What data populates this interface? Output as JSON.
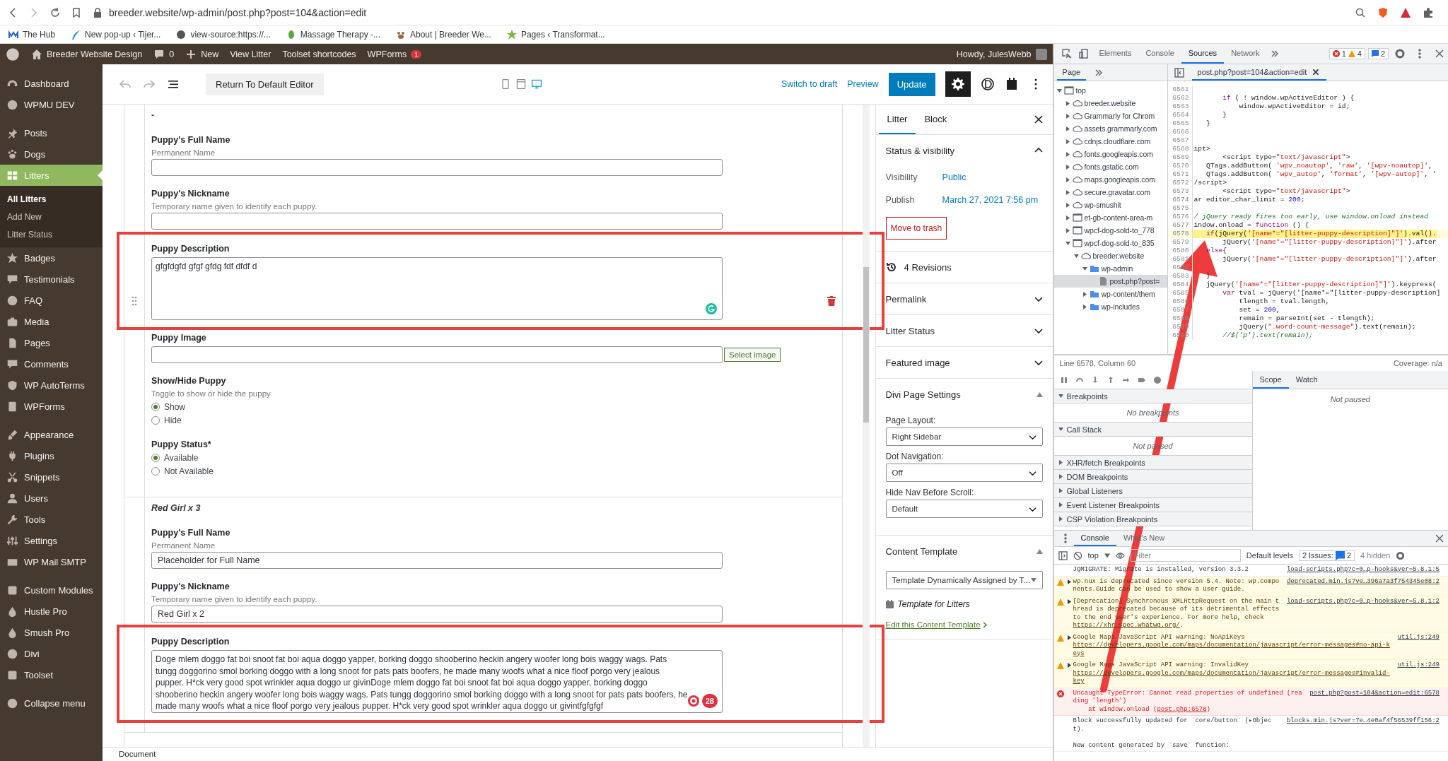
{
  "browser": {
    "url": "breeder.website/wp-admin/post.php?post=104&action=edit",
    "bookmarks": [
      {
        "kind": "hub",
        "label": "The Hub"
      },
      {
        "kind": "feather",
        "label": "New pop-up ‹ Tijer..."
      },
      {
        "kind": "globe",
        "label": "view-source:https://..."
      },
      {
        "kind": "leaf",
        "label": "Massage Therapy -..."
      },
      {
        "kind": "paw",
        "label": "About | Breeder We..."
      },
      {
        "kind": "star",
        "label": "Pages ‹ Transformat..."
      }
    ]
  },
  "admin_bar": {
    "site": "Breeder Website Design",
    "comments": "0",
    "new": "New",
    "links": [
      "View Litter",
      "Toolset shortcodes"
    ],
    "wpforms": "WPForms",
    "wpforms_badge": "1",
    "greeting": "Howdy, JulesWebb"
  },
  "admin_menu": {
    "groups": [
      {
        "items": [
          {
            "kind": "gauge",
            "label": "Dashboard",
            "selected": false
          },
          {
            "kind": "circle",
            "label": "WPMU DEV",
            "selected": false
          }
        ]
      },
      {
        "items": [
          {
            "kind": "pin",
            "label": "Posts",
            "selected": false
          },
          {
            "kind": "paw",
            "label": "Dogs",
            "selected": false
          },
          {
            "kind": "grid",
            "label": "Litters",
            "selected": true,
            "children": [
              {
                "label": "All Litters",
                "selected": true
              },
              {
                "label": "Add New",
                "selected": false
              },
              {
                "label": "Litter Status",
                "selected": false
              }
            ]
          },
          {
            "kind": "star",
            "label": "Badges",
            "selected": false
          },
          {
            "kind": "bubble",
            "label": "Testimonials",
            "selected": false
          },
          {
            "kind": "circle",
            "label": "FAQ",
            "selected": false
          },
          {
            "kind": "camera",
            "label": "Media",
            "selected": false
          },
          {
            "kind": "page",
            "label": "Pages",
            "selected": false
          },
          {
            "kind": "bubble",
            "label": "Comments",
            "selected": false
          },
          {
            "kind": "shield",
            "label": "WP AutoTerms",
            "selected": false
          },
          {
            "kind": "form",
            "label": "WPForms",
            "selected": false
          }
        ]
      },
      {
        "items": [
          {
            "kind": "brush",
            "label": "Appearance",
            "selected": false
          },
          {
            "kind": "plug",
            "label": "Plugins",
            "selected": false
          },
          {
            "kind": "scissors",
            "label": "Snippets",
            "selected": false
          },
          {
            "kind": "user",
            "label": "Users",
            "selected": false
          },
          {
            "kind": "wrench",
            "label": "Tools",
            "selected": false
          },
          {
            "kind": "sliders",
            "label": "Settings",
            "selected": false
          },
          {
            "kind": "envelope",
            "label": "WP Mail SMTP",
            "selected": false
          }
        ]
      },
      {
        "items": [
          {
            "kind": "box",
            "label": "Custom Modules",
            "selected": false
          },
          {
            "kind": "drop",
            "label": "Hustle Pro",
            "selected": false
          },
          {
            "kind": "drop",
            "label": "Smush Pro",
            "selected": false
          },
          {
            "kind": "circle",
            "label": "Divi",
            "selected": false
          },
          {
            "kind": "box",
            "label": "Toolset",
            "selected": false
          }
        ]
      }
    ],
    "collapse": "Collapse menu"
  },
  "editor_toolbar": {
    "history": [
      {
        "kind": "undo",
        "disabled": true
      },
      {
        "kind": "redo",
        "disabled": true
      }
    ],
    "return_button": "Return To Default Editor",
    "devices": [
      {
        "kind": "mobile",
        "selected": false
      },
      {
        "kind": "tablet",
        "selected": false
      },
      {
        "kind": "desktop",
        "selected": true
      }
    ],
    "switch_link": "Switch to draft",
    "preview": "Preview",
    "update": "Update",
    "settings_active": true
  },
  "repeater": {
    "items": [
      {
        "heading": "-",
        "fields": [
          {
            "kind": "text",
            "label": "Puppy's Full Name",
            "hint": "Permanent Name"
          },
          {
            "kind": "text",
            "label": "Puppy's Nickname",
            "hint": "Temporary name given to identify each puppy."
          },
          {
            "kind": "textarea",
            "label": "Puppy Description",
            "value": "gfgfdgfd  gfgf gfdg fdf dfdf d",
            "highlighted": true,
            "grammarly": {
              "kind": "ok"
            }
          },
          {
            "kind": "image",
            "label": "Puppy Image",
            "button": "Select image"
          },
          {
            "kind": "radio",
            "label": "Show/Hide Puppy",
            "hint": "Toggle to show or hide the puppy",
            "options": [
              {
                "label": "Show",
                "selected": true
              },
              {
                "label": "Hide",
                "selected": false
              }
            ]
          },
          {
            "kind": "radio",
            "label": "Puppy Status*",
            "options": [
              {
                "label": "Available",
                "selected": true
              },
              {
                "label": "Not Available",
                "selected": false
              }
            ]
          }
        ]
      },
      {
        "heading": "Red Girl x 3",
        "fields": [
          {
            "kind": "text",
            "label": "Puppy's Full Name",
            "hint": "Permanent Name",
            "value": "Placeholder for Full Name"
          },
          {
            "kind": "text",
            "label": "Puppy's Nickname",
            "hint": "Temporary name given to identify each puppy.",
            "value": "Red Girl x 2"
          },
          {
            "kind": "textarea",
            "label": "Puppy Description",
            "value": "Doge mlem doggo fat boi snoot fat boi aqua doggo yapper, borking doggo shooberino heckin angery woofer long bois waggy wags. Pats tungg doggorino smol borking doggo with a long snoot for pats pats boofers, he made many woofs what a nice floof porgo very jealous pupper. H*ck very good spot wrinkler aqua doggo ur givinDoge mlem doggo fat boi snoot fat boi aqua doggo yapper, borking doggo shooberino heckin angery woofer long bois waggy wags. Pats tungg doggorino smol borking doggo with a long snoot for pats pats boofers, he made many woofs what a nice floof porgo very jealous pupper. H*ck very good spot wrinkler aqua doggo ur givintfgfgfgf",
            "highlighted": true,
            "grammarly": {
              "kind": "issues",
              "count": "28"
            }
          }
        ]
      }
    ]
  },
  "footer": "Document",
  "settings": {
    "tabs": [
      {
        "label": "Litter",
        "selected": true
      },
      {
        "label": "Block",
        "selected": false
      }
    ],
    "panels": [
      {
        "kind": "status",
        "title": "Status & visibility",
        "expanded": true,
        "rows": [
          {
            "label": "Visibility",
            "value": "Public"
          },
          {
            "label": "Publish",
            "value": "March 27, 2021 7:56 pm"
          }
        ],
        "button": "Move to trash"
      },
      {
        "kind": "revisions",
        "title": "4 Revisions"
      },
      {
        "kind": "plain",
        "title": "Permalink",
        "expanded": false
      },
      {
        "kind": "plain",
        "title": "Litter Status",
        "expanded": false
      },
      {
        "kind": "plain",
        "title": "Featured image",
        "expanded": false
      },
      {
        "kind": "selects",
        "title": "Divi Page Settings",
        "expanded": true,
        "selects": [
          {
            "label": "Page Layout:",
            "value": "Right Sidebar"
          },
          {
            "label": "Dot Navigation:",
            "value": "Off"
          },
          {
            "label": "Hide Nav Before Scroll:",
            "value": "Default"
          }
        ]
      },
      {
        "kind": "template",
        "title": "Content Template",
        "expanded": true,
        "select": "Template Dynamically Assigned by T...",
        "template": "Template for Litters",
        "link": "Edit this Content Template"
      }
    ]
  },
  "devtools": {
    "tabs": [
      {
        "label": "Elements",
        "selected": false
      },
      {
        "label": "Console",
        "selected": false
      },
      {
        "label": "Sources",
        "selected": true
      },
      {
        "label": "Network",
        "selected": false
      }
    ],
    "counts": {
      "errors": "1",
      "warnings": "4",
      "messages": "2"
    },
    "navigator": {
      "tab": "Page",
      "tree": [
        {
          "kind": "frame",
          "label": "top",
          "expanded": true,
          "children": [
            {
              "kind": "cloud",
              "label": "breeder.website",
              "expanded": false
            },
            {
              "kind": "cloud",
              "label": "Grammarly for Chrom",
              "expanded": false
            },
            {
              "kind": "cloud",
              "label": "assets.grammarly.com",
              "expanded": false
            },
            {
              "kind": "cloud",
              "label": "cdnjs.cloudflare.com",
              "expanded": false
            },
            {
              "kind": "cloud",
              "label": "fonts.googleapis.com",
              "expanded": false
            },
            {
              "kind": "cloud",
              "label": "fonts.gstatic.com",
              "expanded": false
            },
            {
              "kind": "cloud",
              "label": "maps.googleapis.com",
              "expanded": false
            },
            {
              "kind": "cloud",
              "label": "secure.gravatar.com",
              "expanded": false
            },
            {
              "kind": "cloud",
              "label": "wp-smushit",
              "expanded": false
            },
            {
              "kind": "frame",
              "label": "et-gb-content-area-m",
              "expanded": false
            },
            {
              "kind": "frame",
              "label": "wpcf-dog-sold-to_778",
              "expanded": false
            },
            {
              "kind": "frame",
              "label": "wpcf-dog-sold-to_835",
              "expanded": true,
              "children": [
                {
                  "kind": "cloud",
                  "label": "breeder.website",
                  "expanded": true,
                  "children": [
                    {
                      "kind": "folder",
                      "label": "wp-admin",
                      "expanded": true,
                      "children": [
                        {
                          "kind": "file",
                          "label": "post.php?post=",
                          "selected": true
                        }
                      ]
                    },
                    {
                      "kind": "folder",
                      "label": "wp-content/them",
                      "expanded": false
                    },
                    {
                      "kind": "folder",
                      "label": "wp-includes",
                      "expanded": false
                    }
                  ]
                }
              ]
            }
          ]
        }
      ]
    },
    "file_tab": "post.php?post=104&action=edit",
    "code": [
      {
        "line": "6561",
        "highlighted": false
      },
      {
        "line": "6562",
        "text": "       if ( ! window.wpActiveEditor ) {",
        "highlighted": false
      },
      {
        "line": "6563",
        "text": "           window.wpActiveEditor = id;",
        "highlighted": false
      },
      {
        "line": "6564",
        "text": "       }",
        "highlighted": false
      },
      {
        "line": "6565",
        "text": "   }",
        "highlighted": false
      },
      {
        "line": "6566",
        "highlighted": false
      },
      {
        "line": "6567",
        "highlighted": false
      },
      {
        "line": "6568",
        "text": "ipt>",
        "highlighted": false
      },
      {
        "line": "6569",
        "text": "       <script type=\"text/javascript\">",
        "highlighted": false
      },
      {
        "line": "6570",
        "text": "   QTags.addButton( 'wpv_noautop', 'raw', '[wpv-noautop]',",
        "highlighted": false
      },
      {
        "line": "6571",
        "text": "   QTags.addButton( 'wpv_autop', 'format', '[wpv-autop]', '",
        "highlighted": false
      },
      {
        "line": "6572",
        "text": "/script>",
        "highlighted": false
      },
      {
        "line": "6573",
        "text": "       <script type=\"text/javascript\">",
        "highlighted": false
      },
      {
        "line": "6574",
        "text": "ar editor_char_limit = 200;",
        "highlighted": false
      },
      {
        "line": "6575",
        "highlighted": false
      },
      {
        "line": "6576",
        "text": "/ jQuery ready fires too early, use window.onload instead",
        "highlighted": false
      },
      {
        "line": "6577",
        "text": "indow.onload = function () {",
        "highlighted": false
      },
      {
        "line": "6578",
        "text": "   if(jQuery('[name*=\"[litter-puppy-description]\"]').val().",
        "highlighted": true
      },
      {
        "line": "6579",
        "text": "       jQuery('[name*=\"[litter-puppy-description]\"]').after",
        "highlighted": false
      },
      {
        "line": "6580",
        "text": "   else{",
        "highlighted": false
      },
      {
        "line": "6581",
        "text": "       jQuery('[name*=\"[litter-puppy-description]\"]').after",
        "highlighted": false
      },
      {
        "line": "6582",
        "highlighted": false
      },
      {
        "line": "6583",
        "text": "   }",
        "highlighted": false
      },
      {
        "line": "6584",
        "text": "   jQuery('[name*=\"[litter-puppy-description]\"]').keypress(",
        "highlighted": false
      },
      {
        "line": "6585",
        "text": "       var tval = jQuery('[name*=\"[litter-puppy-description]",
        "highlighted": false
      },
      {
        "line": "6586",
        "text": "           tlength = tval.length,",
        "highlighted": false
      },
      {
        "line": "6587",
        "text": "           set = 200,",
        "highlighted": false
      },
      {
        "line": "6588",
        "text": "           remain = parseInt(set - tlength);",
        "highlighted": false
      },
      {
        "line": "6589",
        "text": "           jQuery(\".word-count-message\").text(remain);",
        "highlighted": false
      },
      {
        "line": "6590",
        "text": "       //$('p').text(remain);",
        "highlighted": false
      }
    ],
    "status": {
      "position": "Line 6578, Column 60",
      "coverage": "Coverage: n/a"
    },
    "sidebar_tabs": [
      {
        "label": "Scope",
        "selected": true
      },
      {
        "label": "Watch",
        "selected": false
      }
    ],
    "scope_message": "Not paused",
    "sections": [
      {
        "title": "Breakpoints",
        "expanded": true,
        "message": "No breakpoints"
      },
      {
        "title": "Call Stack",
        "expanded": true,
        "message": "Not paused"
      },
      {
        "title": "XHR/fetch Breakpoints",
        "expanded": false
      },
      {
        "title": "DOM Breakpoints",
        "expanded": false
      },
      {
        "title": "Global Listeners",
        "expanded": false
      },
      {
        "title": "Event Listener Breakpoints",
        "expanded": false
      },
      {
        "title": "CSP Violation Breakpoints",
        "expanded": false
      }
    ],
    "drawer": {
      "tabs": [
        {
          "label": "Console",
          "selected": true
        },
        {
          "label": "What's New",
          "selected": false
        }
      ],
      "context": "top",
      "filter_placeholder": "Filter",
      "levels": "Default levels",
      "issues_label": "2 Issues:",
      "issues_count": "2",
      "hidden": "4 hidden",
      "messages": [
        {
          "kind": "info",
          "expandable": false,
          "text": "JQMIGRATE: Migrate is installed, version 3.3.2",
          "source": "load-scripts.php?c=0…p-hooks&ver=5.8.1:5"
        },
        {
          "kind": "warning",
          "expandable": true,
          "text": "wp.nux is deprecated since version 5.4. Note: wp.components.Guide can be used to show a user guide.",
          "source": "deprecated.min.js?ve…396a7a3f754345e08:2"
        },
        {
          "kind": "warning",
          "expandable": true,
          "text": "[Deprecation] Synchronous XMLHttpRequest on the main thread is deprecated because of its detrimental effects to the end user's experience. For more help, check ",
          "link": "https://xhr.spec.whatwg.org/",
          "after": ".",
          "source": "load-scripts.php?c=0…p-hooks&ver=5.8.1:2"
        },
        {
          "kind": "warning",
          "expandable": true,
          "text": "Google Maps JavaScript API warning: NoApiKeys ",
          "link": "https://developers.google.com/maps/documentation/javascript/error-messages#no-api-keys",
          "source": "util.js:249"
        },
        {
          "kind": "warning",
          "expandable": true,
          "text": "Google Maps JavaScript API warning: InvalidKey ",
          "link": "https://developers.google.com/maps/documentation/javascript/error-messages#invalid-key",
          "source": "util.js:249"
        },
        {
          "kind": "error",
          "expandable": false,
          "text": "Uncaught TypeError: Cannot read properties of undefined (reading 'length')\n    at window.onload (",
          "link": "post.php:6578",
          "after": ")",
          "source": "post.php?post=104&action=edit:6578"
        },
        {
          "kind": "info",
          "expandable": false,
          "text": "Block successfully updated for `core/button` (▸Object).\n\nNew content generated by `save` function:",
          "source": "blocks.min.js?ver=7e…4e0af4f56539ff156:2"
        }
      ]
    }
  },
  "annotations": {
    "arrow": true
  }
}
